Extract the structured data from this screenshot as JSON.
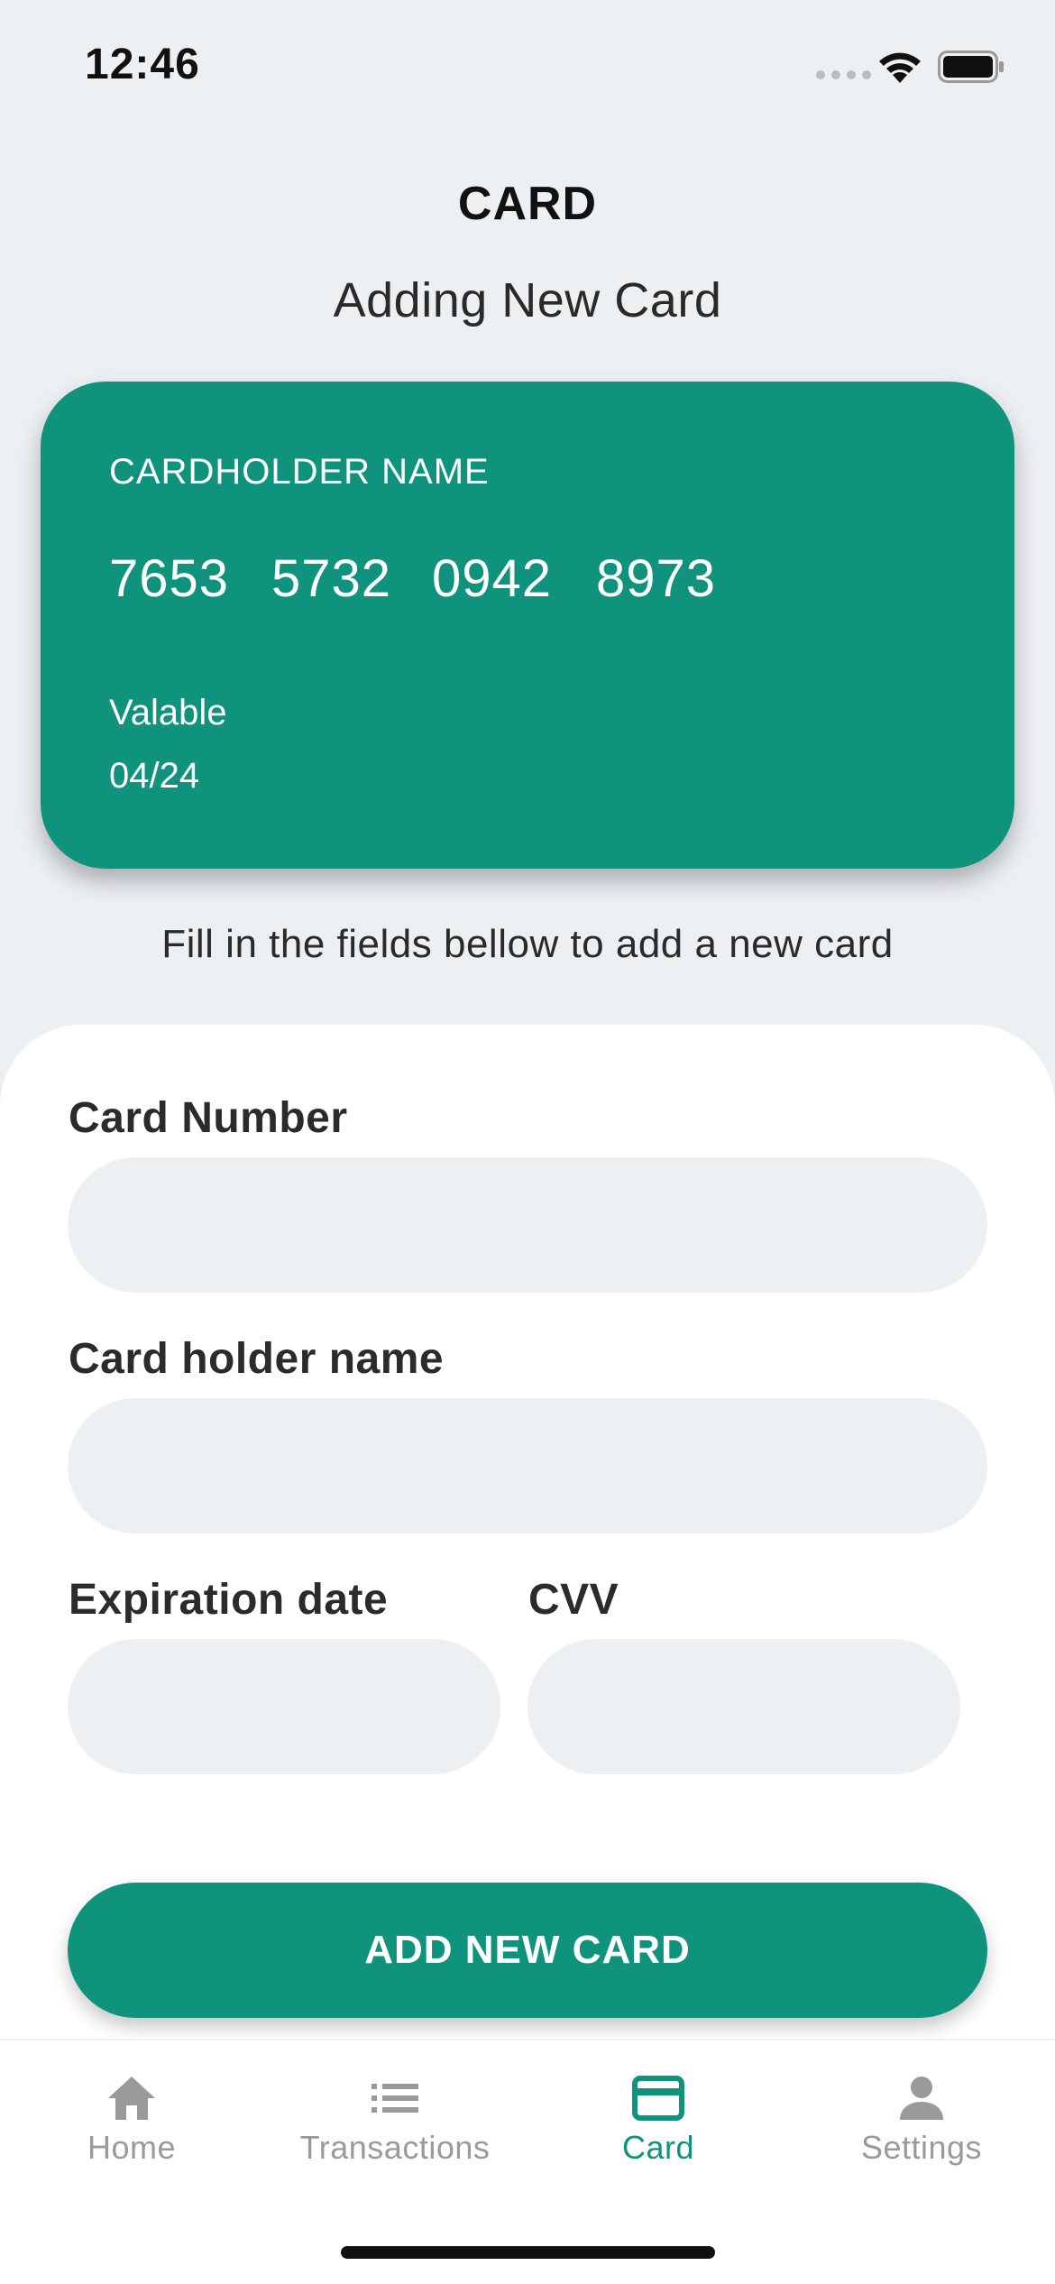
{
  "status_bar": {
    "time": "12:46"
  },
  "header": {
    "title": "CARD",
    "subtitle": "Adding New Card"
  },
  "card_preview": {
    "holder": "CARDHOLDER NAME",
    "number_groups": [
      "7653",
      "5732",
      "0942",
      "8973"
    ],
    "valid_label": "Valable",
    "valid_date": "04/24",
    "color": "#10937d"
  },
  "instructions": "Fill in the fields bellow to add a new card",
  "form": {
    "card_number": {
      "label": "Card Number",
      "value": "",
      "placeholder": ""
    },
    "holder_name": {
      "label": "Card holder name",
      "value": "",
      "placeholder": ""
    },
    "expiration": {
      "label": "Expiration date",
      "value": "",
      "placeholder": ""
    },
    "cvv": {
      "label": "CVV",
      "value": "",
      "placeholder": ""
    },
    "submit_label": "ADD NEW CARD"
  },
  "tab_bar": {
    "active": "Card",
    "accent_color": "#10937d",
    "inactive_color": "#9a9a9a",
    "tabs": [
      {
        "label": "Home",
        "icon": "home-icon"
      },
      {
        "label": "Transactions",
        "icon": "list-icon"
      },
      {
        "label": "Card",
        "icon": "credit-card-icon"
      },
      {
        "label": "Settings",
        "icon": "person-icon"
      }
    ]
  }
}
